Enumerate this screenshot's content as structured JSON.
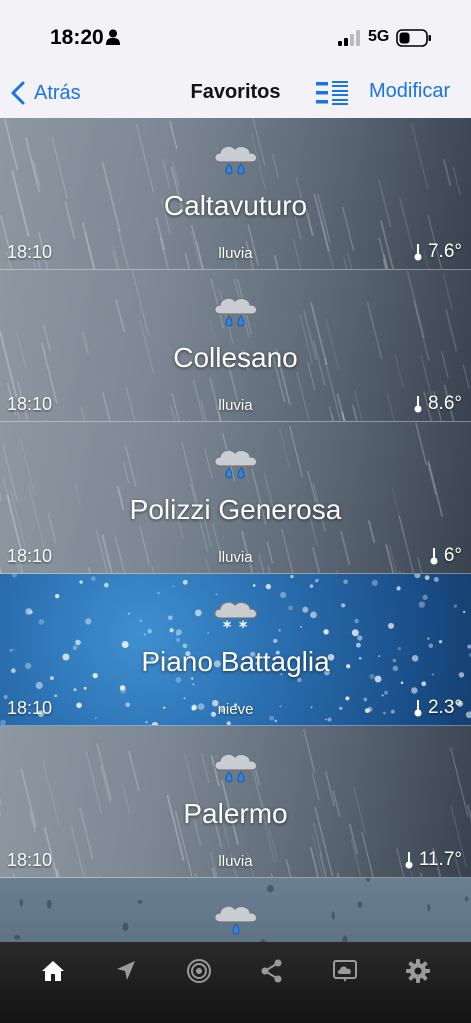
{
  "status_bar": {
    "time": "18:20",
    "network": "5G"
  },
  "nav": {
    "back_label": "Atrás",
    "title": "Favoritos",
    "edit_label": "Modificar",
    "accent_color": "#1a73e8"
  },
  "favorites": [
    {
      "city": "Caltavuturo",
      "time": "18:10",
      "condition": "lluvia",
      "temperature": "7.6°",
      "icon": "rain-cloud-icon",
      "background": "rain"
    },
    {
      "city": "Collesano",
      "time": "18:10",
      "condition": "lluvia",
      "temperature": "8.6°",
      "icon": "rain-cloud-icon",
      "background": "rain"
    },
    {
      "city": "Polizzi Generosa",
      "time": "18:10",
      "condition": "lluvia",
      "temperature": "6°",
      "icon": "rain-cloud-icon",
      "background": "rain"
    },
    {
      "city": "Piano Battaglia",
      "time": "18:10",
      "condition": "nieve",
      "temperature": "2.3°",
      "icon": "snow-cloud-icon",
      "background": "snow"
    },
    {
      "city": "Palermo",
      "time": "18:10",
      "condition": "lluvia",
      "temperature": "11.7°",
      "icon": "rain-cloud-icon",
      "background": "rain"
    },
    {
      "city": "",
      "time": "",
      "condition": "",
      "temperature": "",
      "icon": "drizzle-cloud-icon",
      "background": "drops"
    }
  ],
  "tab_bar": {
    "tabs": [
      "home-icon",
      "location-arrow-icon",
      "radar-icon",
      "share-icon",
      "weather-map-icon",
      "settings-gear-icon"
    ],
    "active": "home-icon"
  }
}
